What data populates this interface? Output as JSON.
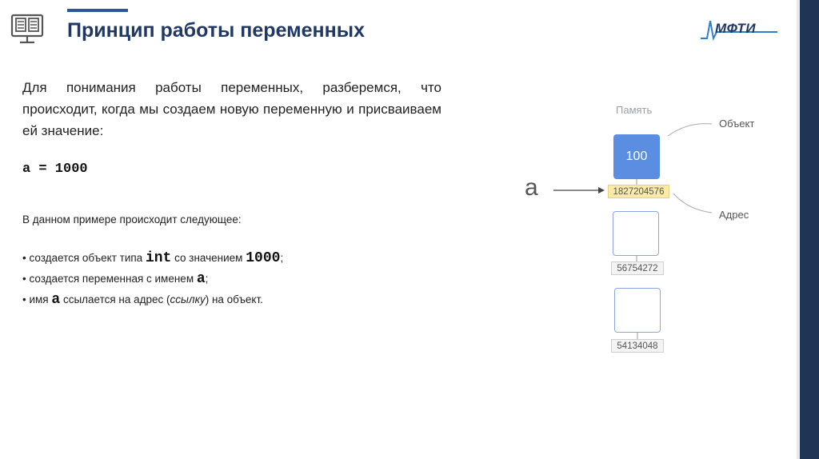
{
  "slide": {
    "title": "Принцип работы переменных",
    "logo_text": "МФТИ",
    "colors": {
      "title": "#1f3864",
      "accent": "#2f5597",
      "cell": "#5b8ee0",
      "address_highlight": "#fbe9a8"
    }
  },
  "content": {
    "intro": "Для понимания работы переменных, разберемся, что происходит, когда мы создаем новую переменную и присваиваем ей значение:",
    "code": "a = 1000",
    "explain_heading": "В данном примере происходит следующее:",
    "bullets": [
      {
        "prefix": "• создается объект типа ",
        "code": "int",
        "middle": " со значением ",
        "code2": "1000",
        "suffix": ";"
      },
      {
        "prefix": "• создается переменная с именем ",
        "code": "a",
        "suffix": ";"
      },
      {
        "prefix": "• имя ",
        "code": "a",
        "middle": " ссылается на адрес (",
        "italic": "ссылку",
        "suffix": ") на объект."
      }
    ]
  },
  "diagram": {
    "memory_label": "Память",
    "object_label": "Объект",
    "address_label": "Адрес",
    "variable": "a",
    "cells": [
      {
        "value": "100",
        "address": "1827204576"
      },
      {
        "value": "",
        "address": "56754272"
      },
      {
        "value": "",
        "address": "54134048"
      }
    ]
  }
}
